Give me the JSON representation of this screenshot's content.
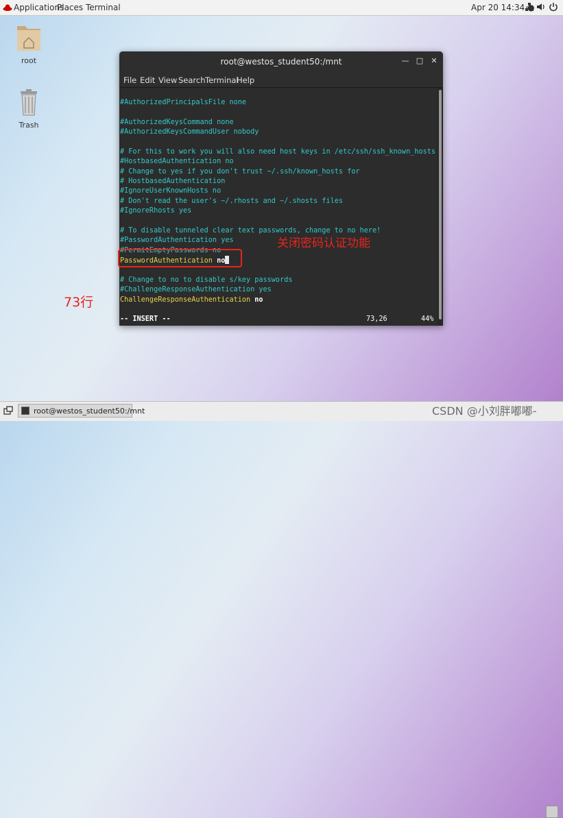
{
  "topbar": {
    "applications": "Applications",
    "places": "Places",
    "terminal": "Terminal",
    "clock": "Apr 20  14:34",
    "icons": [
      "network-icon",
      "volume-icon",
      "power-icon"
    ]
  },
  "desktop": {
    "icons": [
      {
        "label": "root",
        "icon": "home-folder-icon"
      },
      {
        "label": "Trash",
        "icon": "trash-icon"
      }
    ]
  },
  "window": {
    "title": "root@westos_student50:/mnt",
    "controls": [
      "minimize",
      "maximize",
      "close"
    ],
    "menu": [
      "File",
      "Edit",
      "View",
      "Search",
      "Terminal",
      "Help"
    ]
  },
  "editor": {
    "lines": [
      "#AuthorizedPrincipalsFile none",
      "",
      "#AuthorizedKeysCommand none",
      "#AuthorizedKeysCommandUser nobody",
      "",
      "# For this to work you will also need host keys in /etc/ssh/ssh_known_hosts",
      "#HostbasedAuthentication no",
      "# Change to yes if you don't trust ~/.ssh/known_hosts for",
      "# HostbasedAuthentication",
      "#IgnoreUserKnownHosts no",
      "# Don't read the user's ~/.rhosts and ~/.shosts files",
      "#IgnoreRhosts yes",
      "",
      "# To disable tunneled clear text passwords, change to no here!",
      "#PasswordAuthentication yes",
      "#PermitEmptyPasswords no"
    ],
    "active_line": {
      "key": "PasswordAuthentication",
      "value": "no"
    },
    "lines_after": [
      "",
      "# Change to no to disable s/key passwords",
      "#ChallengeResponseAuthentication yes"
    ],
    "challenge_line": {
      "key": "ChallengeResponseAuthentication",
      "value": "no"
    },
    "status_mode": "-- INSERT --",
    "status_position": "73,26",
    "status_percent": "44%"
  },
  "annotations": {
    "note_cn": "关闭密码认证功能",
    "note_line": "73行",
    "color": "#e8251c"
  },
  "taskbar": {
    "task_label": "root@westos_student50:/mnt",
    "watermark": "CSDN @小刘胖嘟嘟-"
  }
}
